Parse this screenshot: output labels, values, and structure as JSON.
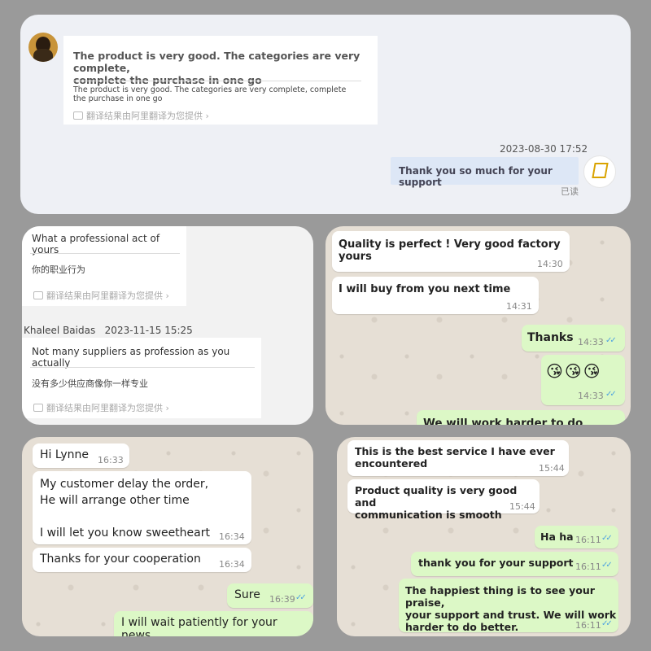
{
  "p1": {
    "in_title": "The product is very good. The categories are very complete,\ncomplete the purchase in one go",
    "in_sub": "The product is very good. The categories are very complete, complete the purchase in one go",
    "translate_note": "翻译结果由阿里翻译为您提供",
    "timestamp": "2023-08-30 17:52",
    "out_text": "Thank you so much for your support",
    "read_status": "已读"
  },
  "p2": {
    "m1_en": "What a professional act of yours",
    "m1_cn": "你的职业行为",
    "translate_note": "翻译结果由阿里翻译为您提供",
    "sender": "Khaleel Baidas",
    "sender_time": "2023-11-15 15:25",
    "m2_en": "Not many suppliers as profession as you actually",
    "m2_cn": "没有多少供应商像你一样专业"
  },
  "p3": {
    "m1": "Quality is perfect ! Very good factory yours",
    "m1_time": "14:30",
    "m2": "I will buy from you next time",
    "m2_time": "14:31",
    "m3": "Thanks",
    "m3_time": "14:33",
    "m4": "😘😘😘",
    "m4_time": "14:33",
    "m5": "We will work harder to do better"
  },
  "p4": {
    "m1": "Hi Lynne",
    "m1_time": "16:33",
    "m2": "My customer delay the order,\nHe will arrange other time\n\nI will let you know sweetheart",
    "m2_time": "16:34",
    "m3": "Thanks for your cooperation",
    "m3_time": "16:34",
    "m4": "Sure",
    "m4_time": "16:39",
    "m5": "I will wait patiently for your news."
  },
  "p5": {
    "m1": "This is the best service I have ever\nencountered",
    "m1_time": "15:44",
    "m2": "Product quality is very good and\ncommunication is smooth",
    "m2_time": "15:44",
    "m3": "Ha ha",
    "m3_time": "16:11",
    "m4": "thank you for your support",
    "m4_time": "16:11",
    "m5": "The happiest thing is to see your praise,\nyour support and trust. We will work\nharder to do better.",
    "m5_time": "16:11"
  }
}
